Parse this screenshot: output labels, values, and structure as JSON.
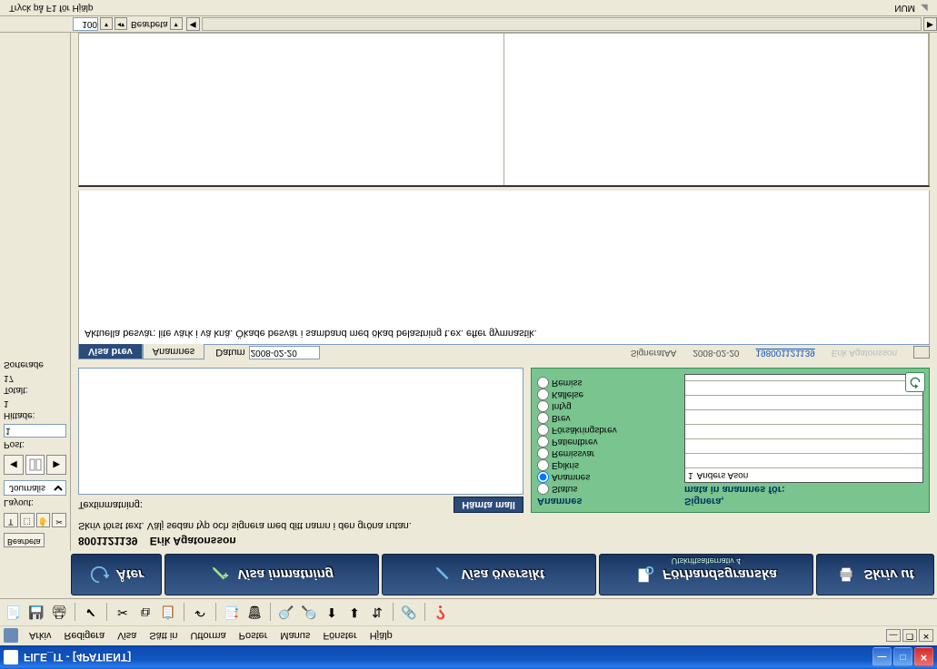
{
  "window": {
    "title": "FILE_IT - [4PATIENT]"
  },
  "menu": {
    "items": [
      "Arkiv",
      "Redigera",
      "Visa",
      "Sätt in",
      "Utforma",
      "Poster",
      "Manus",
      "Fönster",
      "Hjälp"
    ]
  },
  "actions": {
    "back": "Åter",
    "input": "Visa inmatning",
    "overview": "Visa översikt",
    "preview": "Förhandsgranska",
    "preview_sub": "Utskriftsalternativ  4",
    "print": "Skriv ut"
  },
  "left": {
    "bearb": "Bearbeta",
    "layout": "Layout:",
    "layout_val": "Journalis",
    "post": "Post:",
    "post_val": "1",
    "hittade": "Hittade:",
    "hittade_val": "1",
    "totalt": "Totalt:",
    "totalt_val": "17",
    "sorterade": "Sorterade"
  },
  "patient": {
    "pid": "8001121139",
    "name": "Erik Agatonsson",
    "hint": "Skriv först text. Välj sedan typ och signera med ditt namn i den gröna rutan.",
    "textinmatning": "Textinmatning:",
    "hamta": "Hämta mall"
  },
  "sign": {
    "radios_hdr": "Anamnes",
    "radios": [
      "Status",
      "Anamnes",
      "Epikris",
      "Remissvar",
      "Patientbrev",
      "Försäkringsbrev",
      "Brev",
      "Intyg",
      "Kallelse",
      "Remiss"
    ],
    "selected": 1,
    "right_hdr1": "Signera,",
    "right_hdr2": "mata in anamnes för:",
    "signers": [
      {
        "idx": "1",
        "name": "Anders Ason"
      }
    ]
  },
  "tabs": {
    "visa_brev": "Visa brev",
    "anamnes": "Anamnes",
    "datum_lbl": "Datum",
    "datum_val": "2008-02-20",
    "signerat": "SigneratAA",
    "sigdate": "2008-02-20",
    "pid_link": "198001121139",
    "ghost": "Erik Agatonsson"
  },
  "doc": {
    "memo": "Aktuella besvär: lite värk i vä knä. Ökade besvär i samband med ökad belastning t.ex. efter gymnastik."
  },
  "scroll": {
    "zoom": "100",
    "mode": "Bearbeta"
  },
  "status": {
    "help": "Tryck på F1 för Hjälp",
    "num": "NUM"
  }
}
